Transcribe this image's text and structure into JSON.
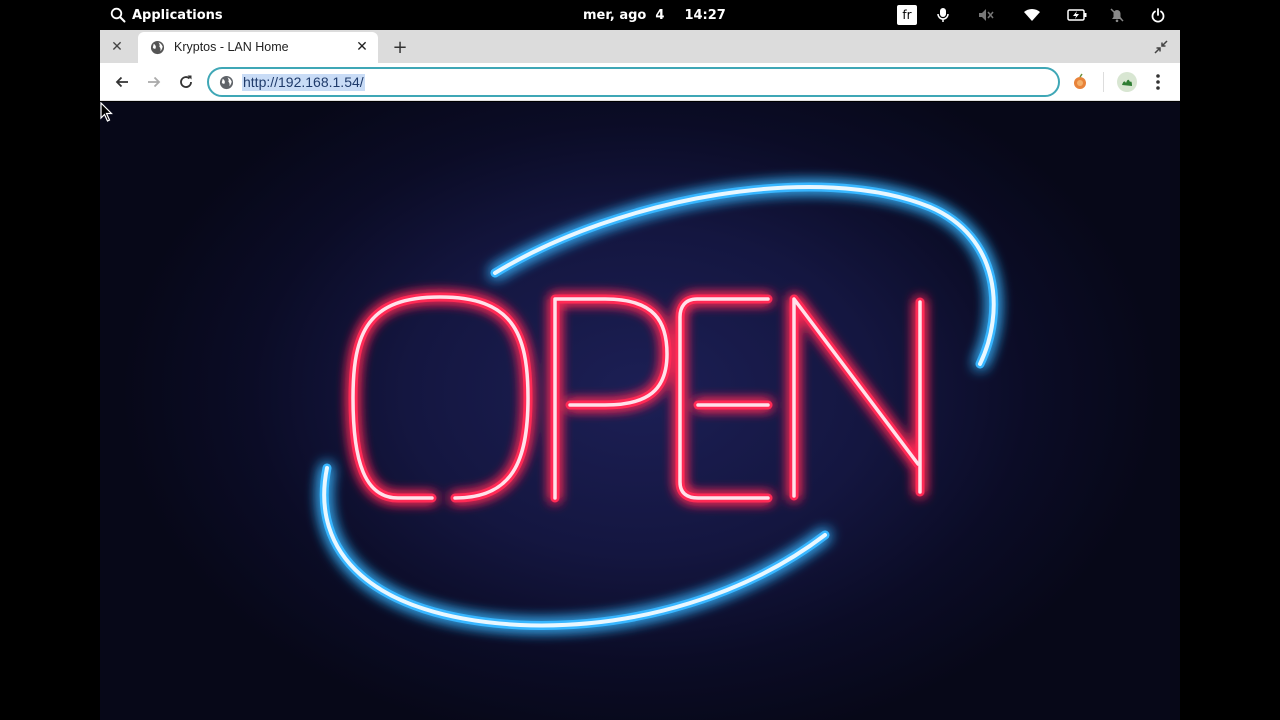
{
  "topbar": {
    "applications_label": "Applications",
    "date": "mer, ago  4",
    "time": "14:27",
    "keyboard_layout": "fr",
    "icons": [
      "search-icon",
      "microphone-icon",
      "speaker-muted-icon",
      "wifi-icon",
      "battery-charging-icon",
      "notifications-off-icon",
      "power-icon"
    ]
  },
  "browser": {
    "tab": {
      "title": "Kryptos - LAN Home",
      "favicon": "globe-icon"
    },
    "address": {
      "url": "http://192.168.1.54/"
    },
    "toolbar_icons": [
      "back-arrow-icon",
      "forward-arrow-icon",
      "reload-icon",
      "extension-icon",
      "profile-icon",
      "menu-icon"
    ]
  },
  "content": {
    "sign_text": "OPEN",
    "colors": {
      "letters": "#ff2a55",
      "ring": "#38b6ff",
      "background": "#141640"
    }
  }
}
